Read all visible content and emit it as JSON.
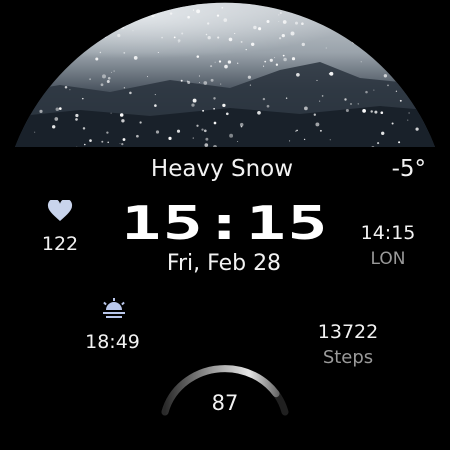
{
  "weather": {
    "condition": "Heavy Snow",
    "temperature": "-5°",
    "background_image": "snowfall-photo"
  },
  "clock": {
    "time": "15:15",
    "date": "Fri, Feb 28"
  },
  "heart_rate": {
    "icon": "heart-icon",
    "value": "122"
  },
  "world_clock": {
    "time": "14:15",
    "city": "LON"
  },
  "sunset": {
    "icon": "sunset-icon",
    "time": "18:49"
  },
  "steps": {
    "value": "13722",
    "label": "Steps"
  },
  "battery": {
    "value": "87",
    "level": 0.87
  },
  "colors": {
    "background": "#000000",
    "text": "#f2f2f2",
    "muted": "#9a9a9a",
    "heart": "#c9d4ec",
    "sun": "#b8c6ea"
  }
}
